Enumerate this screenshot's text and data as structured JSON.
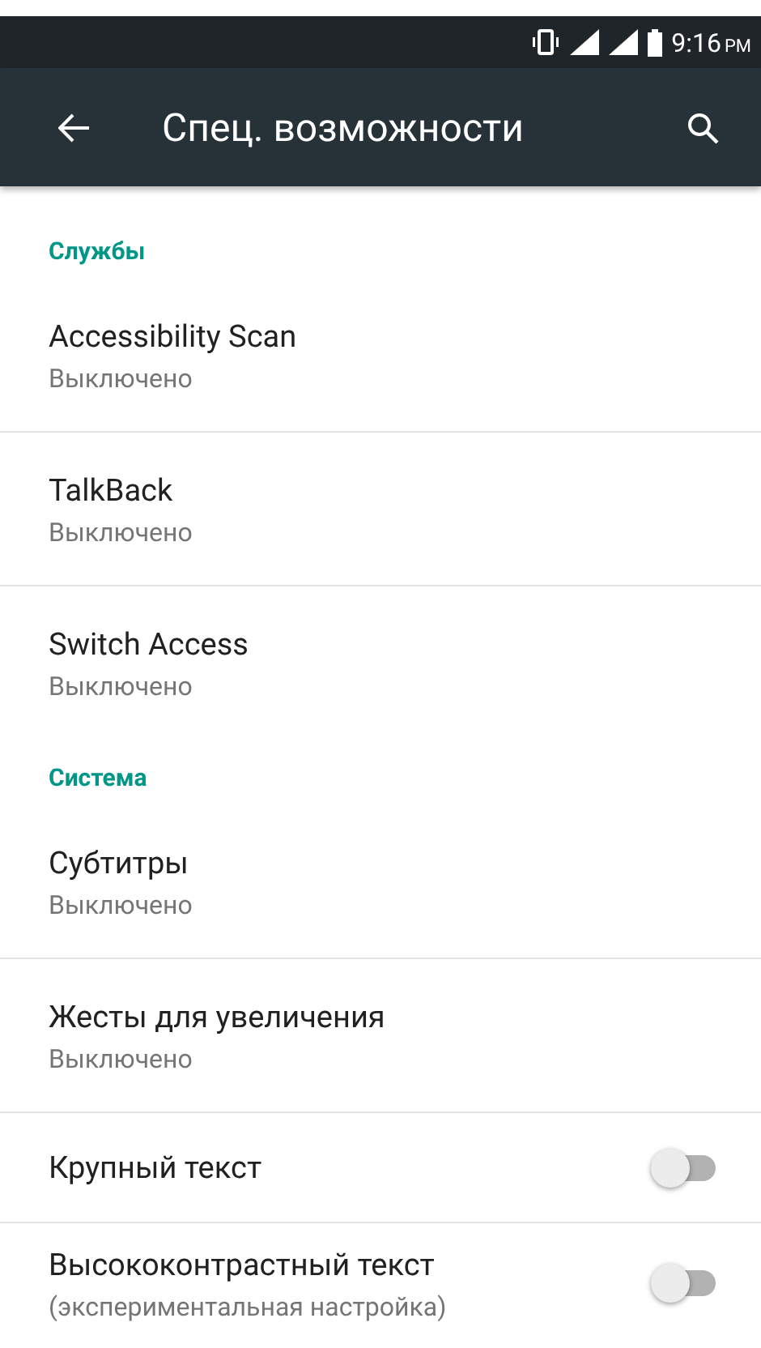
{
  "status_bar": {
    "time": "9:16",
    "ampm": "PM"
  },
  "toolbar": {
    "title": "Спец. возможности"
  },
  "sections": [
    {
      "title": "Службы",
      "items": [
        {
          "kind": "text",
          "title": "Accessibility Scan",
          "summary": "Выключено"
        },
        {
          "kind": "text",
          "title": "TalkBack",
          "summary": "Выключено"
        },
        {
          "kind": "text",
          "title": "Switch Access",
          "summary": "Выключено"
        }
      ]
    },
    {
      "title": "Система",
      "items": [
        {
          "kind": "text",
          "title": "Субтитры",
          "summary": "Выключено"
        },
        {
          "kind": "text",
          "title": "Жесты для увеличения",
          "summary": "Выключено"
        },
        {
          "kind": "switch",
          "title": "Крупный текст",
          "on": false
        },
        {
          "kind": "switch",
          "title": "Высококонтрастный текст",
          "summary": "(экспериментальная настройка)",
          "on": false
        }
      ]
    }
  ]
}
